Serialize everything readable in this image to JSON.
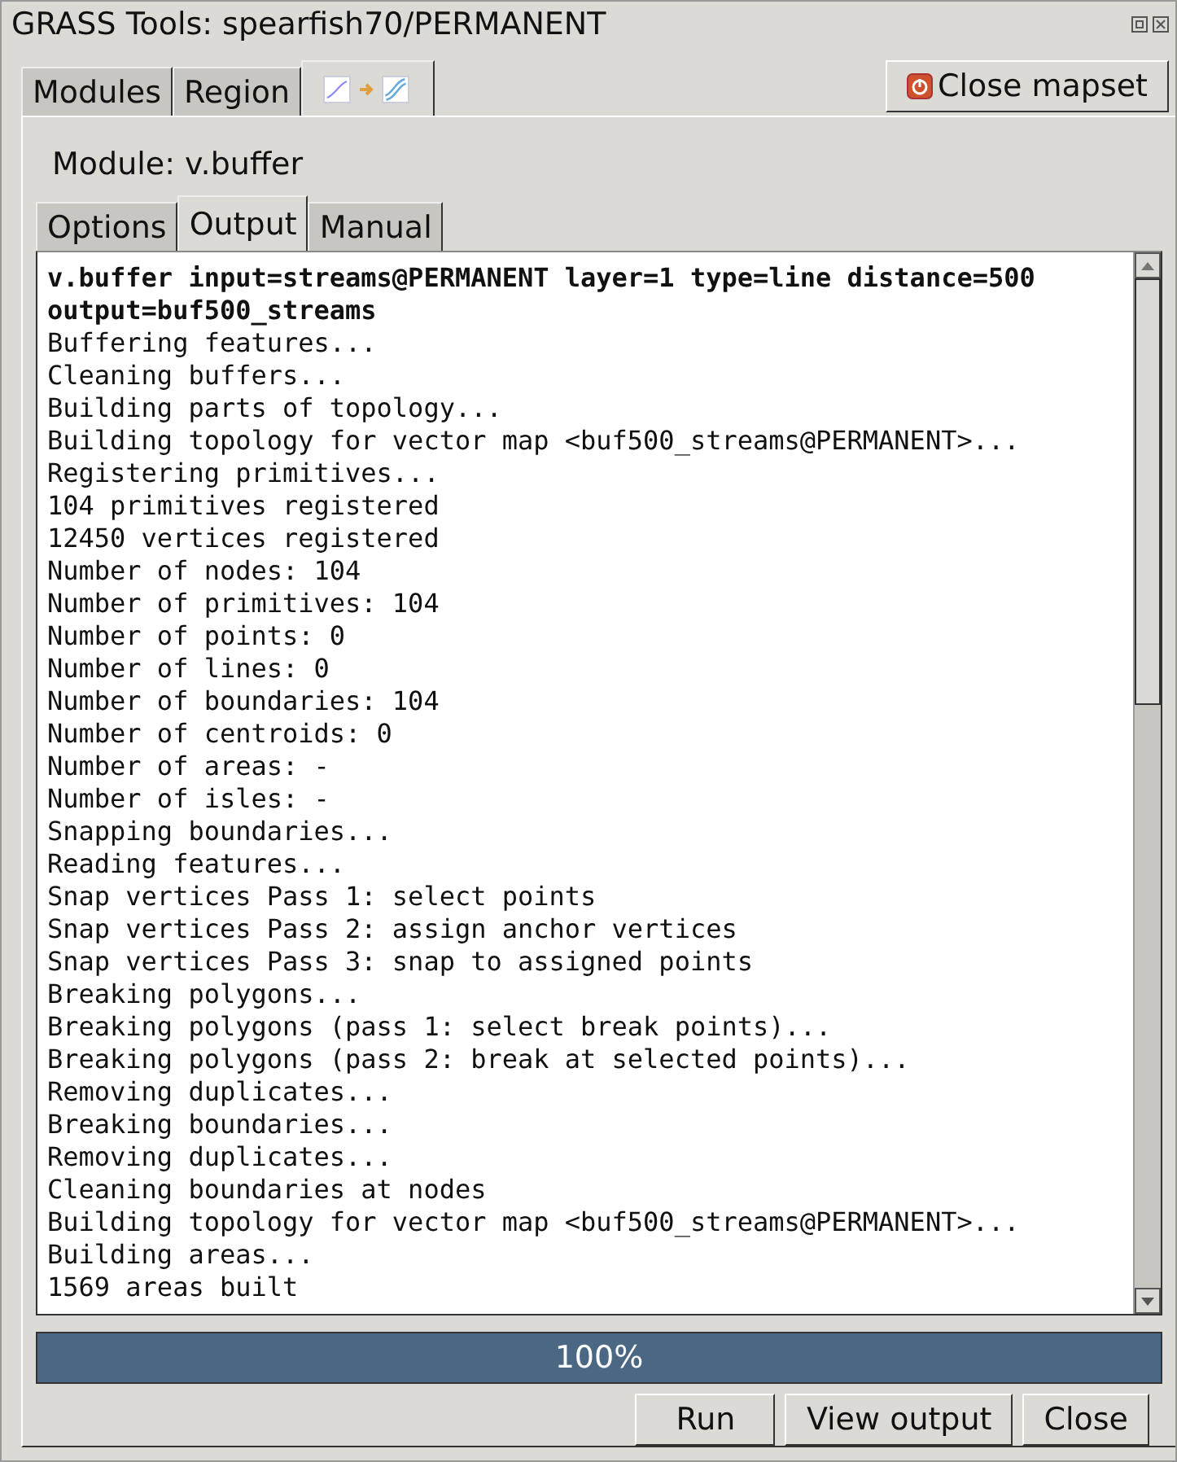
{
  "window": {
    "title": "GRASS Tools: spearfish70/PERMANENT"
  },
  "top_tabs": [
    {
      "label": "Modules",
      "kind": "text",
      "selected": false
    },
    {
      "label": "Region",
      "kind": "text",
      "selected": false
    },
    {
      "kind": "icon",
      "selected": true
    }
  ],
  "close_mapset_button": {
    "label": "Close mapset"
  },
  "module_label": "Module: v.buffer",
  "module_tabs": [
    {
      "label": "Options",
      "selected": false
    },
    {
      "label": "Output",
      "selected": true
    },
    {
      "label": "Manual",
      "selected": false
    }
  ],
  "output": {
    "command": "v.buffer input=streams@PERMANENT layer=1 type=line distance=500 output=buf500_streams",
    "lines": [
      "Buffering features...",
      "Cleaning buffers...",
      "Building parts of topology...",
      "Building topology for vector map <buf500_streams@PERMANENT>...",
      "Registering primitives...",
      "104 primitives registered",
      "12450 vertices registered",
      "Number of nodes: 104",
      "Number of primitives: 104",
      "Number of points: 0",
      "Number of lines: 0",
      "Number of boundaries: 104",
      "Number of centroids: 0",
      "Number of areas: -",
      "Number of isles: -",
      "Snapping boundaries...",
      "Reading features...",
      "Snap vertices Pass 1: select points",
      "Snap vertices Pass 2: assign anchor vertices",
      "Snap vertices Pass 3: snap to assigned points",
      "Breaking polygons...",
      "Breaking polygons (pass 1: select break points)...",
      "Breaking polygons (pass 2: break at selected points)...",
      "Removing duplicates...",
      "Breaking boundaries...",
      "Removing duplicates...",
      "Cleaning boundaries at nodes",
      "Building topology for vector map <buf500_streams@PERMANENT>...",
      "Building areas...",
      "1569 areas built"
    ]
  },
  "progress": {
    "level": 1,
    "label": "100%"
  },
  "buttons": [
    "Run",
    "View output",
    "Close"
  ]
}
